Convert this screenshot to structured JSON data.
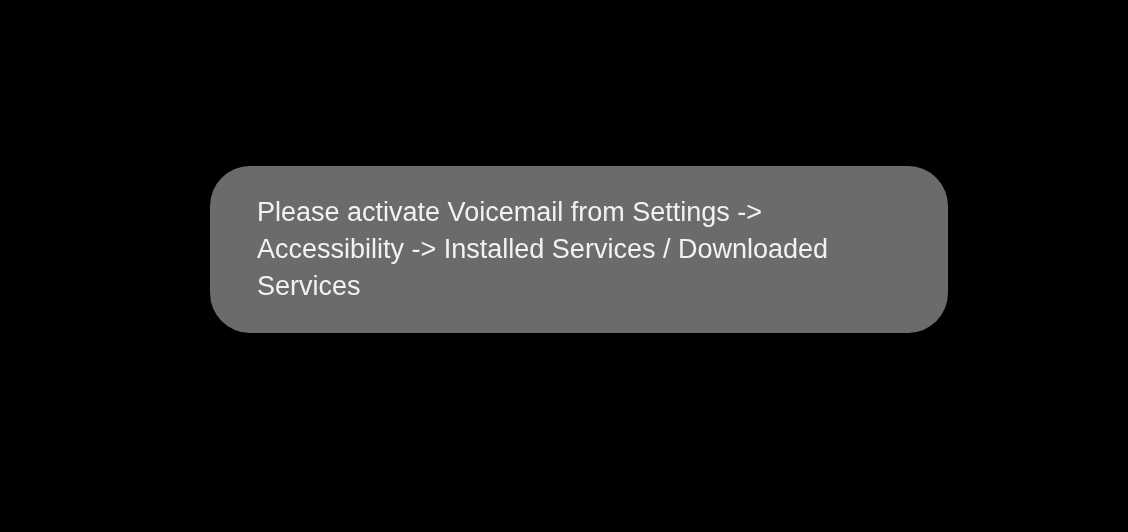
{
  "toast": {
    "message": "Please activate Voicemail from Settings -> Accessibility -> Installed Services / Downloaded Services"
  }
}
